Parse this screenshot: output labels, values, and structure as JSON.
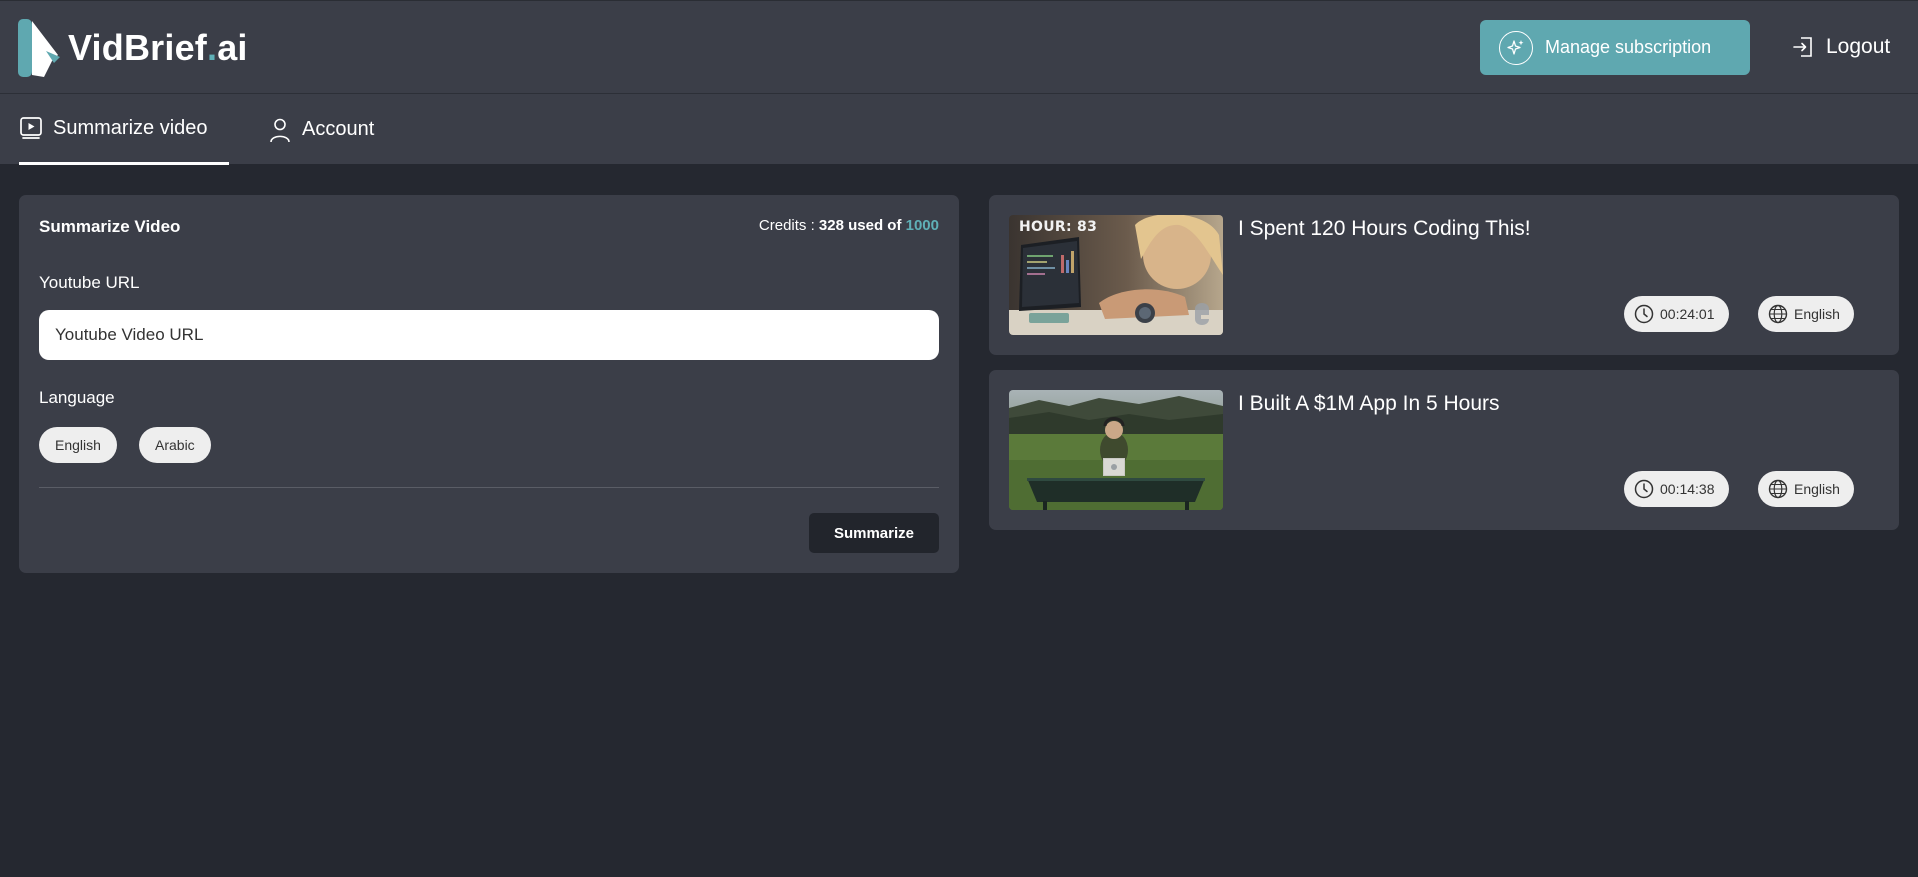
{
  "header": {
    "logo_text": "VidBrief",
    "logo_dot": ".",
    "logo_suffix": "ai",
    "manage_label": "Manage subscription",
    "logout_label": "Logout"
  },
  "tabs": [
    {
      "label": "Summarize video",
      "icon": "play-square-icon",
      "active": true
    },
    {
      "label": "Account",
      "icon": "user-icon",
      "active": false
    }
  ],
  "summarize": {
    "title": "Summarize Video",
    "credits_prefix": "Credits : ",
    "credits_used": "328 used of",
    "credits_total": "1000",
    "url_label": "Youtube URL",
    "url_placeholder": "Youtube Video URL",
    "url_value": "",
    "language_label": "Language",
    "languages": [
      "English",
      "Arabic"
    ],
    "button_label": "Summarize"
  },
  "videos": [
    {
      "title": "I Spent 120 Hours Coding This!",
      "thumb_text": "HOUR: 83",
      "duration": "00:24:01",
      "language": "English"
    },
    {
      "title": "I Built A $1M App In 5 Hours",
      "duration": "00:14:38",
      "language": "English"
    }
  ],
  "colors": {
    "accent": "#5fa8b0",
    "background": "#252830",
    "panel": "#3b3e48"
  }
}
